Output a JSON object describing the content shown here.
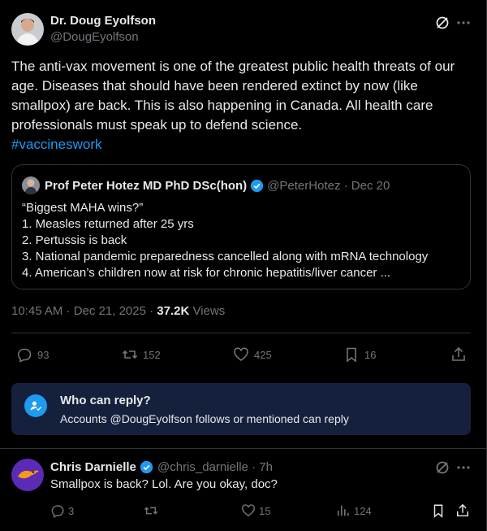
{
  "post": {
    "author_name": "Dr. Doug Eyolfson",
    "author_handle": "@DougEyolfson",
    "text": "The anti-vax movement is one of the greatest public health threats of our age. Diseases that should have been rendered extinct by now (like smallpox) are back. This is also happening in Canada. All health care professionals must speak up to defend science.",
    "hashtag": "#vaccineswork",
    "timestamp": "10:45 AM · Dec 21, 2025 · ",
    "views_count": "37.2K",
    "views_label": " Views",
    "replies": "93",
    "reposts": "152",
    "likes": "425",
    "bookmarks": "16"
  },
  "quote": {
    "name": "Prof Peter Hotez MD PhD DSc(hon)",
    "meta": "@PeterHotez · Dec 20",
    "lines": [
      "“Biggest MAHA wins?”",
      "1. Measles returned after 25 yrs",
      "2. Pertussis is back",
      "3. National pandemic preparedness cancelled along with mRNA technology",
      "4. American’s children now at risk for chronic hepatitis/liver cancer ..."
    ]
  },
  "who_can_reply": {
    "title": "Who can reply?",
    "subtitle": "Accounts @DougEyolfson follows or mentioned can reply"
  },
  "reply": {
    "author_name": "Chris Darnielle",
    "meta": "@chris_darnielle · 7h",
    "text": "Smallpox is back? Lol. Are you okay, doc?",
    "replies": "3",
    "likes": "15",
    "views": "124"
  },
  "colors": {
    "accent": "#1d9bf0",
    "muted": "#71767b",
    "text": "#e7e9ea",
    "background": "#000000",
    "reply_box": "#15213c"
  },
  "icons": [
    "grok-icon",
    "more-icon",
    "verified-icon",
    "reply-icon",
    "repost-icon",
    "like-icon",
    "bookmark-icon",
    "share-icon",
    "views-icon",
    "reply-settings-icon"
  ]
}
